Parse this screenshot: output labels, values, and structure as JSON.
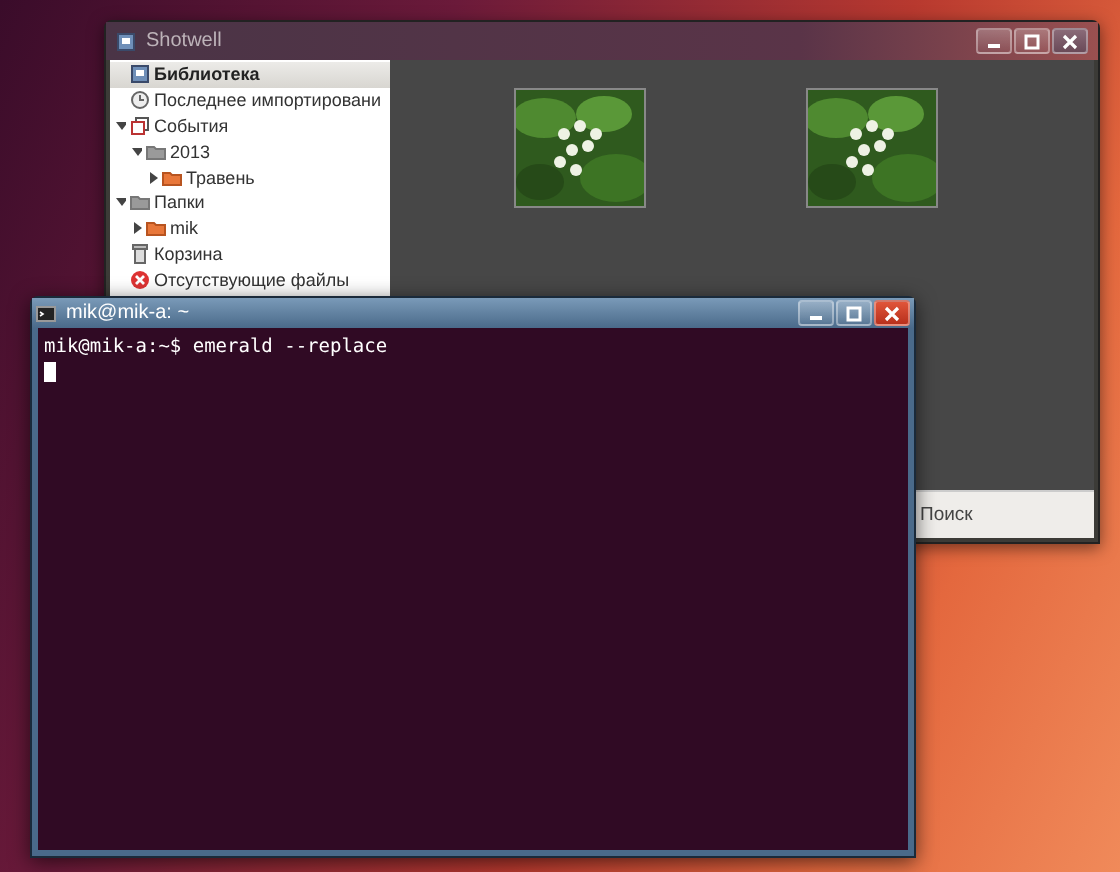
{
  "windows": [
    {
      "kind": "shotwell",
      "title": "Shotwell",
      "active": false,
      "sidebar": {
        "items": [
          {
            "label": "Библиотека",
            "kind": "library",
            "selected": true
          },
          {
            "label": "Последнее импортировани",
            "kind": "recent",
            "selected": false
          },
          {
            "label": "События",
            "kind": "events",
            "selected": false,
            "expanded": true,
            "children": [
              {
                "label": "2013",
                "kind": "folder",
                "selected": false,
                "expanded": true,
                "children": [
                  {
                    "label": "Травень",
                    "kind": "folder-orange",
                    "selected": false,
                    "expanded": false
                  }
                ]
              }
            ]
          },
          {
            "label": "Папки",
            "kind": "folder",
            "selected": false,
            "expanded": true,
            "children": [
              {
                "label": "mik",
                "kind": "folder-orange",
                "selected": false,
                "expanded": false
              }
            ]
          },
          {
            "label": "Корзина",
            "kind": "trash",
            "selected": false
          },
          {
            "label": "Отсутствующие файлы",
            "kind": "missing",
            "selected": false
          }
        ]
      },
      "status_bar": {
        "search_label": "Поиск"
      }
    },
    {
      "kind": "terminal",
      "title": "mik@mik-a: ~",
      "active": true,
      "lines": [
        "mik@mik-a:~$ emerald --replace"
      ]
    }
  ]
}
